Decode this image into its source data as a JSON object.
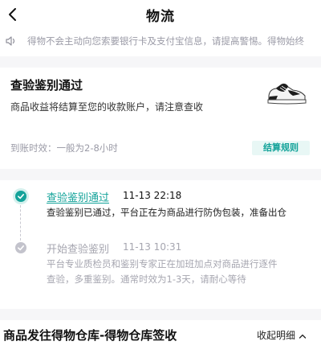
{
  "header": {
    "title": "物流"
  },
  "notice": {
    "text": "得物不会主动向您索要银行卡及支付宝信息，请提高警惕。得物始终"
  },
  "status_card": {
    "title": "查验鉴别通过",
    "subtitle": "商品收益将结算至您的收款账户，请注意查收",
    "arrival_text": "到账时效：一般为2-8小时",
    "rule_button": "结算规则"
  },
  "timeline": [
    {
      "title": "查验鉴别通过",
      "time": "11-13 22:18",
      "desc": "查验鉴别已通过，平台正在为商品进行防伪包装，准备出仓"
    },
    {
      "title": "开始查验鉴别",
      "time": "11-13 10:31",
      "desc": "平台专业质检员和鉴别专家正在加班加点对商品进行逐件查验，多重鉴别。通常时效为1-3天，请耐心等待"
    }
  ],
  "section": {
    "title": "商品发往得物仓库-得物仓库签收",
    "collapse_label": "收起明细"
  },
  "colors": {
    "accent": "#14a39a",
    "muted": "#a6a6b0",
    "divider_bg": "#f6f6f8"
  },
  "icons": [
    "back-arrow-icon",
    "speaker-icon",
    "sneaker-image",
    "check-icon",
    "chevron-up-icon"
  ]
}
